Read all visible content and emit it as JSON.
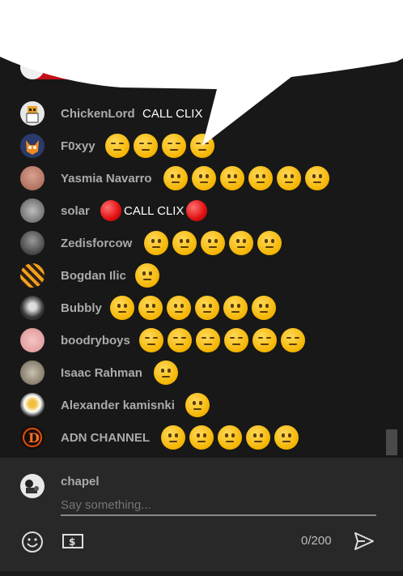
{
  "messages": [
    {
      "author": "ChickenLord",
      "text": "CALL CLIX",
      "emojis": []
    },
    {
      "author": "F0xyy",
      "text": "",
      "emojis": [
        "expr",
        "expr",
        "expr",
        "expr"
      ]
    },
    {
      "author": "Yasmia Navarro",
      "text": "",
      "emojis": [
        "neutral",
        "neutral",
        "neutral",
        "neutral",
        "neutral",
        "neutral"
      ]
    },
    {
      "author": "solar",
      "text": "CALL CLIX",
      "emojis": []
    },
    {
      "author": "Zedisforcow",
      "text": "",
      "emojis": [
        "neutral",
        "neutral",
        "neutral",
        "neutral",
        "neutral"
      ]
    },
    {
      "author": "Bogdan Ilic",
      "text": "",
      "emojis": [
        "neutral"
      ]
    },
    {
      "author": "Bubbly",
      "text": "",
      "emojis": [
        "neutral",
        "neutral",
        "neutral",
        "neutral",
        "neutral",
        "neutral"
      ]
    },
    {
      "author": "boodryboys",
      "text": "",
      "emojis": [
        "expr",
        "expr",
        "expr",
        "expr",
        "expr",
        "expr"
      ]
    },
    {
      "author": "Isaac Rahman",
      "text": "",
      "emojis": [
        "neutral"
      ]
    },
    {
      "author": "Alexander kamisnki",
      "text": "",
      "emojis": [
        "neutral"
      ]
    },
    {
      "author": "ADN CHANNEL",
      "text": "",
      "emojis": [
        "neutral",
        "neutral",
        "neutral",
        "neutral",
        "neutral"
      ]
    }
  ],
  "composer": {
    "user": "chapel",
    "placeholder": "Say something...",
    "counter": "0/200",
    "emoji_icon": "smile-icon",
    "superchat_icon": "dollar-icon",
    "send_icon": "send-icon"
  },
  "colors": {
    "bg": "#181818",
    "author": "#aaaaaa",
    "text": "#ffffff",
    "composer_bg": "#282828"
  }
}
